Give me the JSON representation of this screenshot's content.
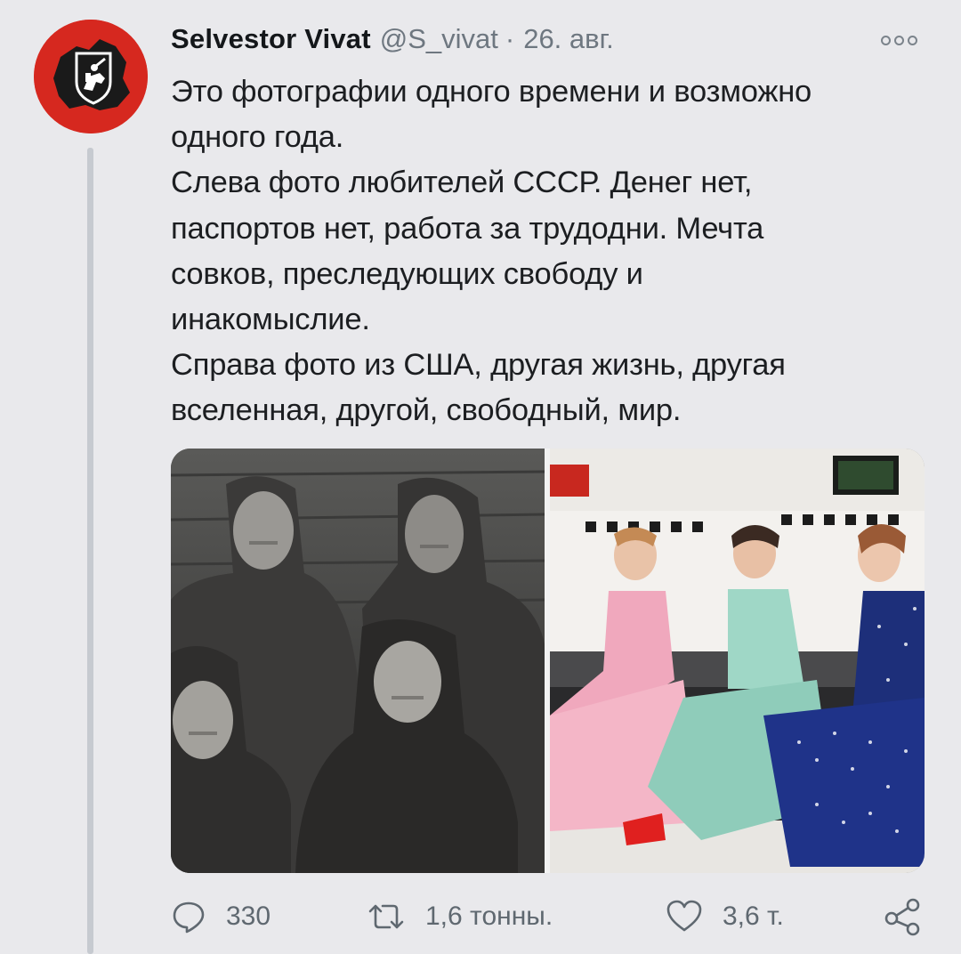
{
  "author": {
    "display_name": "Selvestor Vivat",
    "handle": "@S_vivat",
    "separator": "·",
    "date": "26. авг."
  },
  "tweet": {
    "lines": [
      "Это фотографии одного времени и возможно",
      "одного года.",
      "Слева фото любителей СССР. Денег нет,",
      "паспортов нет, работа за трудодни. Мечта",
      "совков, преследующих свободу и",
      "инакомыслие.",
      "Справа фото из США, другая жизнь, другая",
      "вселенная, другой, свободный, мир."
    ]
  },
  "media": {
    "left_image": "black-and-white photo of four women in headscarves",
    "right_image": "color photo of three women in 1950s dresses at a diner"
  },
  "actions": {
    "reply_count": "330",
    "retweet_count": "1,6 тонны.",
    "like_count": "3,6 т.",
    "icons": [
      "reply-icon",
      "retweet-icon",
      "like-icon",
      "share-icon"
    ]
  },
  "colors": {
    "background": "#e9e9ec",
    "avatar_red": "#d6281f",
    "muted_text": "#6e7780",
    "action_icon": "#5f6870"
  }
}
